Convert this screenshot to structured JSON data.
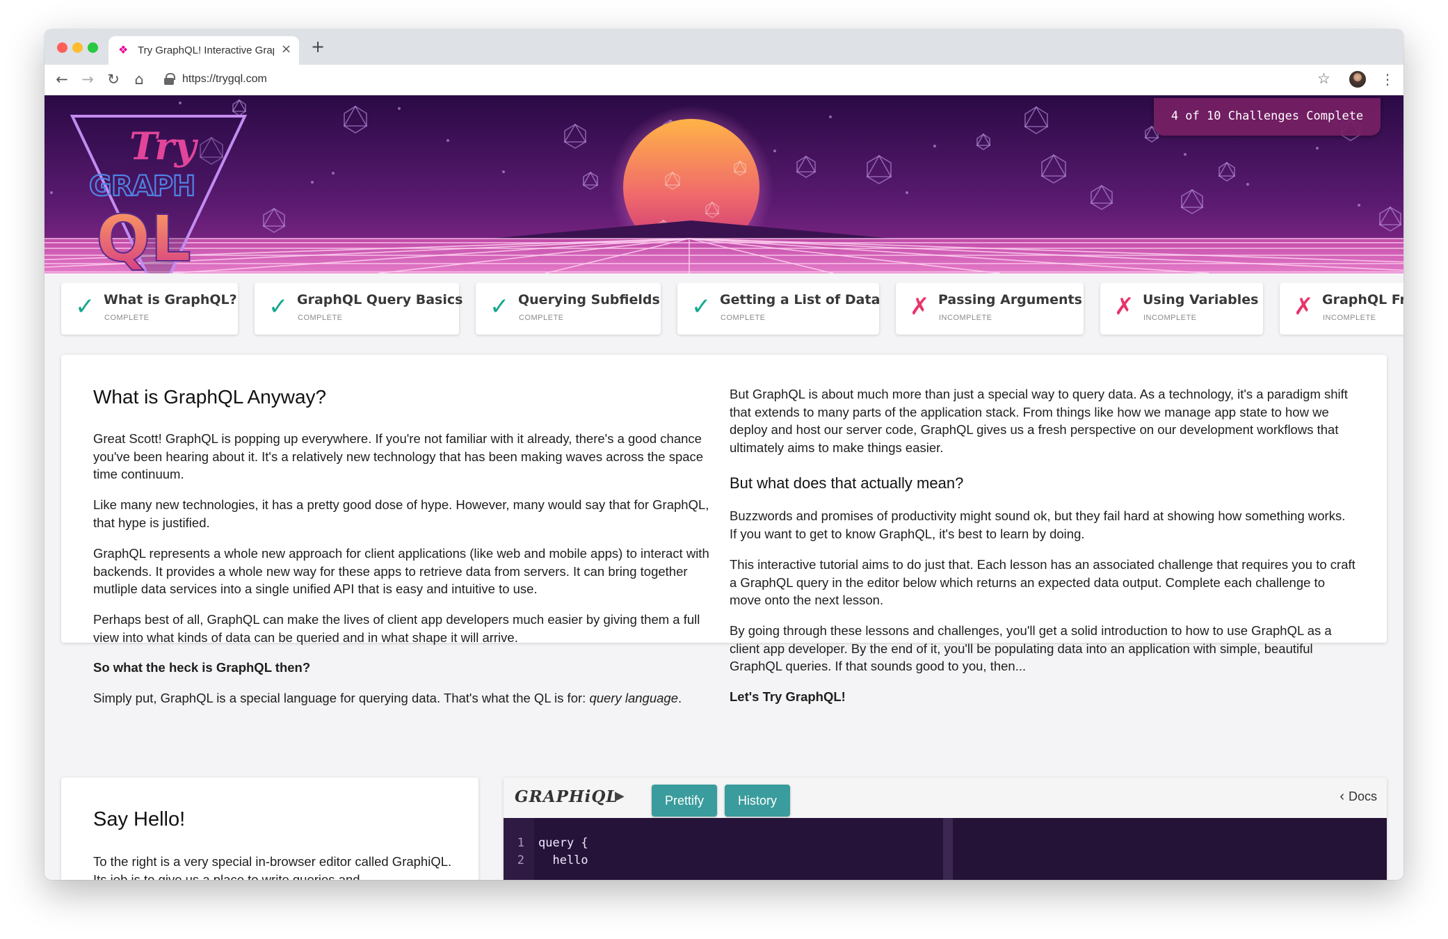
{
  "browser": {
    "tab_title": "Try GraphQL! Interactive Graph",
    "url": "https://trygql.com",
    "icons": {
      "back": "←",
      "forward": "→",
      "reload": "↻",
      "home": "⌂",
      "star": "☆",
      "menu": "⋮",
      "close": "×",
      "new_tab": "+"
    }
  },
  "hero": {
    "logo_line1": "Try",
    "logo_line2": "GRAPH",
    "logo_line3": "QL",
    "challenges_badge": "4 of 10 Challenges Complete",
    "colors": {
      "sky_top": "#2a0a45",
      "sky_bottom": "#8e2b8c",
      "sun_top": "#ffb347",
      "sun_bottom": "#c8307a",
      "grid": "#ff9ad8"
    }
  },
  "lessons": [
    {
      "title": "What is GraphQL?",
      "status": "COMPLETE",
      "complete": true
    },
    {
      "title": "GraphQL Query Basics",
      "status": "COMPLETE",
      "complete": true
    },
    {
      "title": "Querying Subfields",
      "status": "COMPLETE",
      "complete": true
    },
    {
      "title": "Getting a List of Data",
      "status": "COMPLETE",
      "complete": true
    },
    {
      "title": "Passing Arguments",
      "status": "INCOMPLETE",
      "complete": false
    },
    {
      "title": "Using Variables",
      "status": "INCOMPLETE",
      "complete": false
    },
    {
      "title": "GraphQL Fragments",
      "status": "INCOMPLETE",
      "complete": false
    }
  ],
  "lesson_icons": {
    "complete": "✓",
    "incomplete": "✗"
  },
  "intro": {
    "heading": "What is GraphQL Anyway?",
    "p1": "Great Scott! GraphQL is popping up everywhere. If you're not familiar with it already, there's a good chance you've been hearing about it. It's a relatively new technology that has been making waves across the space time continuum.",
    "p2": "Like many new technologies, it has a pretty good dose of hype. However, many would say that for GraphQL, that hype is justified.",
    "p3": "GraphQL represents a whole new approach for client applications (like web and mobile apps) to interact with backends. It provides a whole new way for these apps to retrieve data from servers. It can bring together mutliple data services into a single unified API that is easy and intuitive to use.",
    "p4": "Perhaps best of all, GraphQL can make the lives of client app developers much easier by giving them a full view into what kinds of data can be queried and in what shape it will arrive.",
    "p5": "So what the heck is GraphQL then?",
    "p6_pre": "Simply put, GraphQL is a special language for querying data. That's what the QL is for: ",
    "p6_em": "query language",
    "p6_post": ".",
    "r1": "But GraphQL is about much more than just a special way to query data. As a technology, it's a paradigm shift that extends to many parts of the application stack. From things like how we manage app state to how we deploy and host our server code, GraphQL gives us a fresh perspective on our development workflows that ultimately aims to make things easier.",
    "r_heading": "But what does that actually mean?",
    "r2": "Buzzwords and promises of productivity might sound ok, but they fail hard at showing how something works. If you want to get to know GraphQL, it's best to learn by doing.",
    "r3": "This interactive tutorial aims to do just that. Each lesson has an associated challenge that requires you to craft a GraphQL query in the editor below which returns an expected data output. Complete each challenge to move onto the next lesson.",
    "r4": "By going through these lessons and challenges, you'll get a solid introduction to how to use GraphQL as a client app developer. By the end of it, you'll be populating data into an application with simple, beautiful GraphQL queries. If that sounds good to you, then...",
    "r5": "Let's Try GraphQL!"
  },
  "say_hello": {
    "heading": "Say Hello!",
    "text": "To the right is a very special in-browser editor called GraphiQL. Its job is to give us a place to write queries and"
  },
  "graphiql": {
    "logo": "GRAPHiQL",
    "run_icon": "▶",
    "prettify_label": "Prettify",
    "history_label": "History",
    "docs_chevron": "‹",
    "docs_label": "Docs",
    "accent": "#3a9c9c",
    "lines": [
      {
        "n": "1",
        "code": "query {"
      },
      {
        "n": "2",
        "code": "  hello"
      }
    ]
  }
}
